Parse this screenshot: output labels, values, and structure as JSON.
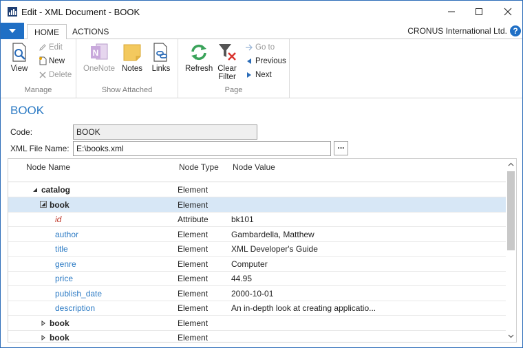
{
  "window": {
    "title": "Edit - XML Document - BOOK"
  },
  "ribbon_tabs": {
    "home": "HOME",
    "actions": "ACTIONS",
    "company": "CRONUS International Ltd.",
    "help": "?"
  },
  "ribbon": {
    "manage": {
      "label": "Manage",
      "view": "View",
      "edit": "Edit",
      "new": "New",
      "delete": "Delete"
    },
    "show_attached": {
      "label": "Show Attached",
      "onenote": "OneNote",
      "notes": "Notes",
      "links": "Links"
    },
    "page": {
      "label": "Page",
      "refresh": "Refresh",
      "clear_filter_line1": "Clear",
      "clear_filter_line2": "Filter",
      "go_to": "Go to",
      "previous": "Previous",
      "next": "Next"
    }
  },
  "form": {
    "title": "BOOK",
    "code_label": "Code:",
    "code_value": "BOOK",
    "file_label": "XML File Name:",
    "file_value": "E:\\books.xml",
    "browse": "..."
  },
  "grid": {
    "headers": {
      "name": "Node Name",
      "type": "Node Type",
      "value": "Node Value"
    },
    "rows": [
      {
        "name": "catalog",
        "type": "Element",
        "value": "",
        "style": "plain",
        "expander": "expanded"
      },
      {
        "name": "book",
        "type": "Element",
        "value": "",
        "style": "plain",
        "expander": "boxed",
        "selected": true
      },
      {
        "name": "id",
        "type": "Attribute",
        "value": "bk101",
        "style": "red",
        "expander": "none"
      },
      {
        "name": "author",
        "type": "Element",
        "value": "Gambardella, Matthew",
        "style": "blue",
        "expander": "none"
      },
      {
        "name": "title",
        "type": "Element",
        "value": "XML Developer's Guide",
        "style": "blue",
        "expander": "none"
      },
      {
        "name": "genre",
        "type": "Element",
        "value": "Computer",
        "style": "blue",
        "expander": "none"
      },
      {
        "name": "price",
        "type": "Element",
        "value": "44.95",
        "style": "blue",
        "expander": "none"
      },
      {
        "name": "publish_date",
        "type": "Element",
        "value": "2000-10-01",
        "style": "blue",
        "expander": "none"
      },
      {
        "name": "description",
        "type": "Element",
        "value": "An in-depth look at creating applicatio...",
        "style": "blue",
        "expander": "none"
      },
      {
        "name": "book",
        "type": "Element",
        "value": "",
        "style": "plain",
        "expander": "collapsed"
      },
      {
        "name": "book",
        "type": "Element",
        "value": "",
        "style": "plain",
        "expander": "collapsed"
      }
    ]
  },
  "colors": {
    "accent": "#1f6fc5",
    "title_blue": "#2b7ac4",
    "selected_row": "#d7e7f6",
    "attribute_red": "#c0392b"
  }
}
